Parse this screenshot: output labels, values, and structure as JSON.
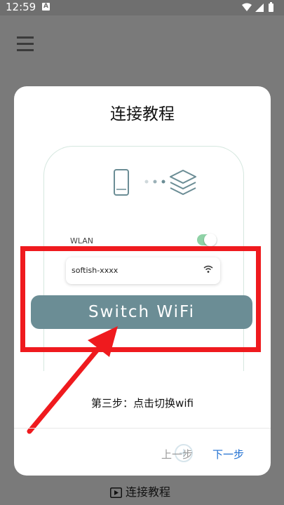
{
  "status_bar": {
    "time": "12:59",
    "a_badge": "A"
  },
  "menu": {
    "icon": "hamburger-menu-icon"
  },
  "dialog": {
    "title": "连接教程",
    "wlan_label": "WLAN",
    "wifi_name": "softish-xxxx",
    "switch_button": "Switch WiFi",
    "step_text": "第三步：点击切换wifi",
    "prev_label": "上一步",
    "next_label": "下一步"
  },
  "bottom": {
    "tutorial_label": "连接教程"
  },
  "colors": {
    "highlight": "#ef1a1e",
    "switch_button": "#6b8d95",
    "toggle_on": "#8fd2a6",
    "next_link": "#1f6fd1"
  }
}
